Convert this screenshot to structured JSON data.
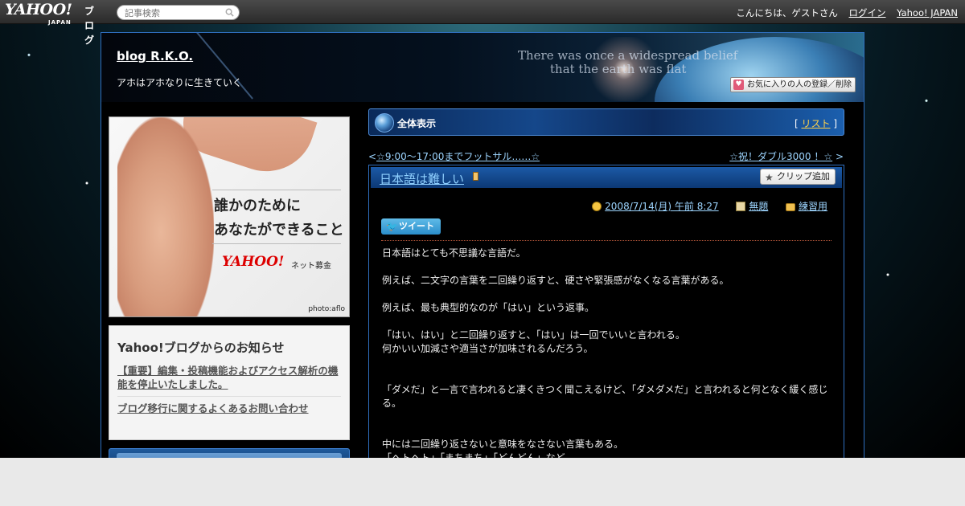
{
  "topbar": {
    "logo": "YAHOO!",
    "logo_sub": "JAPAN",
    "logo_service": "ブログ",
    "search_placeholder": "記事検索",
    "greeting": "こんにちは、ゲストさん",
    "login": "ログイン",
    "yahoo_japan": "Yahoo! JAPAN"
  },
  "header": {
    "blog_title": "blog R.K.O.",
    "blog_description": "アホはアホなりに生きていく",
    "banner_text_1": "There was once a widespread belief",
    "banner_text_2": "that the earth was flat",
    "favorite_button": "お気に入りの人の登録／削除"
  },
  "sidebar": {
    "ad": {
      "line1": "誰かのために",
      "line2": "あなたができること",
      "brand": "YAHOO!",
      "brand_sub": "ネット募金",
      "credit": "photo:aflo"
    },
    "notice": {
      "title": "Yahoo!ブログからのお知らせ",
      "items": [
        "【重要】編集・投稿機能およびアクセス解析の機能を停止いたしました。",
        "ブログ移行に関するよくあるお問い合わせ"
      ]
    }
  },
  "list_bar": {
    "title": "全体表示",
    "list_link": "リスト"
  },
  "nav": {
    "prev": "☆9:00～17:00までフットサル……☆",
    "next": "☆祝！ダブル3000 ！☆"
  },
  "article": {
    "title": "日本語は難しい",
    "clip_button": "クリップ追加",
    "date": "2008/7/14(月) 午前 8:27",
    "theme": "無題",
    "category": "練習用",
    "tweet": "ツイート",
    "paragraphs": [
      "日本語はとても不思議な言語だ。",
      "",
      "例えば、二文字の言葉を二回繰り返すと、硬さや緊張感がなくなる言葉がある。",
      "",
      "例えば、最も典型的なのが「はい」という返事。",
      "",
      "「はい、はい」と二回繰り返すと、「はい」は一回でいいと言われる。",
      "何かいい加減さや適当さが加味されるんだろう。",
      "",
      "",
      "「ダメだ」と一言で言われると凄くきつく聞こえるけど、「ダメダメだ」と言われると何となく緩く感じる。",
      "",
      "",
      "中には二回繰り返さないと意味をなさない言葉もある。",
      "「ヘトヘト」「まちまち」「どんどん」など"
    ]
  },
  "colors": {
    "accent": "#2f6fbf",
    "link": "#9dd5ff",
    "title_link": "#8fd0ff",
    "list_link": "#ffd24a"
  }
}
